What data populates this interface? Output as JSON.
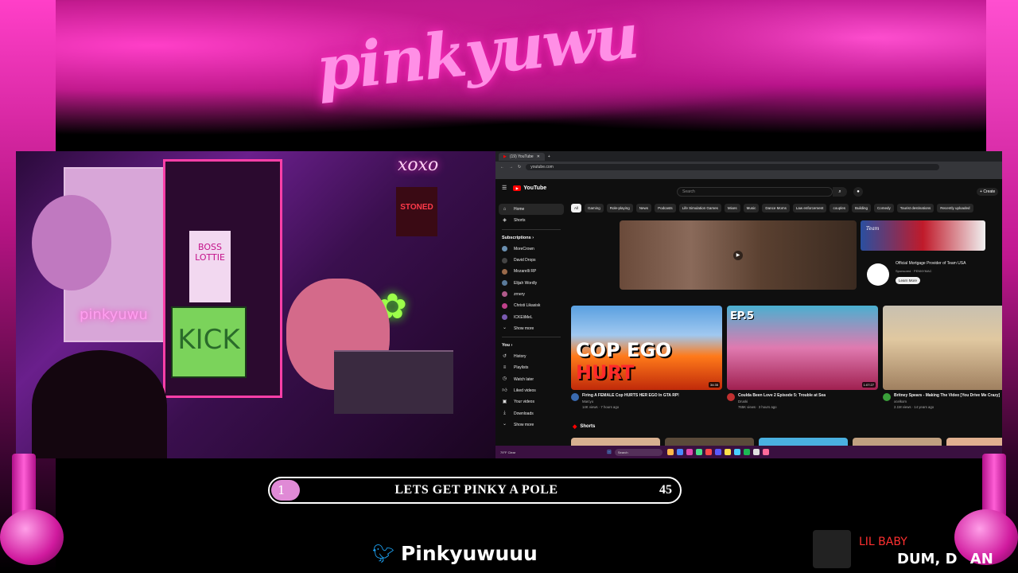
{
  "overlay": {
    "logo": "pinkyuwu",
    "goal": {
      "rank": "1",
      "label": "LETS GET PINKY A POLE",
      "count": "45",
      "progress": 0.07
    },
    "twitter_handle": "Pinkyuwuuu",
    "now_playing": {
      "artist": "LIL BABY",
      "song": "DUM, D",
      "song_tail": "AN"
    },
    "colors": {
      "accent": "#ff3fc8",
      "goal_fill": "#e08ad6"
    }
  },
  "webcam": {
    "signs": {
      "boss": "BOSS LOTTIE",
      "kick": "KICK",
      "neon_name": "pinkyuwu",
      "neon_xoxo": "xoxo",
      "stoned": "STONED"
    }
  },
  "browser": {
    "tab_title": "(19) YouTube",
    "url": "youtube.com"
  },
  "youtube": {
    "logo": "YouTube",
    "search_placeholder": "Search",
    "create_label": "Create",
    "sidebar": {
      "main": [
        {
          "label": "Home",
          "icon": "home-icon"
        },
        {
          "label": "Shorts",
          "icon": "shorts-icon"
        }
      ],
      "subscriptions_header": "Subscriptions",
      "subscriptions": [
        "MoreCrown",
        "David Drops",
        "Mozarelli RP",
        "Elijah Wordly",
        "zrnery",
        "Christi Likasisk",
        "ICKEliMeL"
      ],
      "show_more": "Show more",
      "you_header": "You",
      "you_items": [
        {
          "label": "History",
          "icon": "history-icon"
        },
        {
          "label": "Playlists",
          "icon": "playlists-icon"
        },
        {
          "label": "Watch later",
          "icon": "watch-later-icon"
        },
        {
          "label": "Liked videos",
          "icon": "like-icon"
        },
        {
          "label": "Your videos",
          "icon": "your-videos-icon"
        },
        {
          "label": "Downloads",
          "icon": "download-icon"
        },
        {
          "label": "Show more",
          "icon": "chevron-down-icon"
        }
      ]
    },
    "chips": [
      "All",
      "Gaming",
      "Role-playing",
      "News",
      "Podcasts",
      "Life Simulation Games",
      "Mixes",
      "Music",
      "Dance Moms",
      "Law enforcement",
      "couples",
      "Building",
      "Comedy",
      "Tourist destinations",
      "Recently uploaded"
    ],
    "ad": {
      "title": "Official Mortgage Provider of Team USA",
      "sponsor": "Sponsored · PENNYMAC",
      "cta": "Learn More",
      "banner_text": "Team"
    },
    "videos": [
      {
        "title": "Firing A FEMALE Cop HURTS HER EGO In GTA RP!",
        "channel": "Marcyo",
        "meta": "14K views · 7 hours ago",
        "duration": "34:35",
        "thumb_text_a": "COP EGO",
        "thumb_text_b": "HURT"
      },
      {
        "title": "Coulda Been Love 2 Episode 5: Trouble at Sea",
        "channel": "Druski",
        "meta": "765K views · 3 hours ago",
        "duration": "1:07:27",
        "thumb_text_a": "EP.5",
        "thumb_text_b": ""
      },
      {
        "title": "Britney Spears - Making The Video [You Drive Me Crazy]",
        "channel": "ocelkom",
        "meta": "2.1M views · 14 years ago",
        "duration": "",
        "thumb_text_a": "",
        "thumb_text_b": ""
      }
    ],
    "shorts_label": "Shorts"
  },
  "taskbar": {
    "weather": "79°F Clear",
    "search": "Search"
  }
}
